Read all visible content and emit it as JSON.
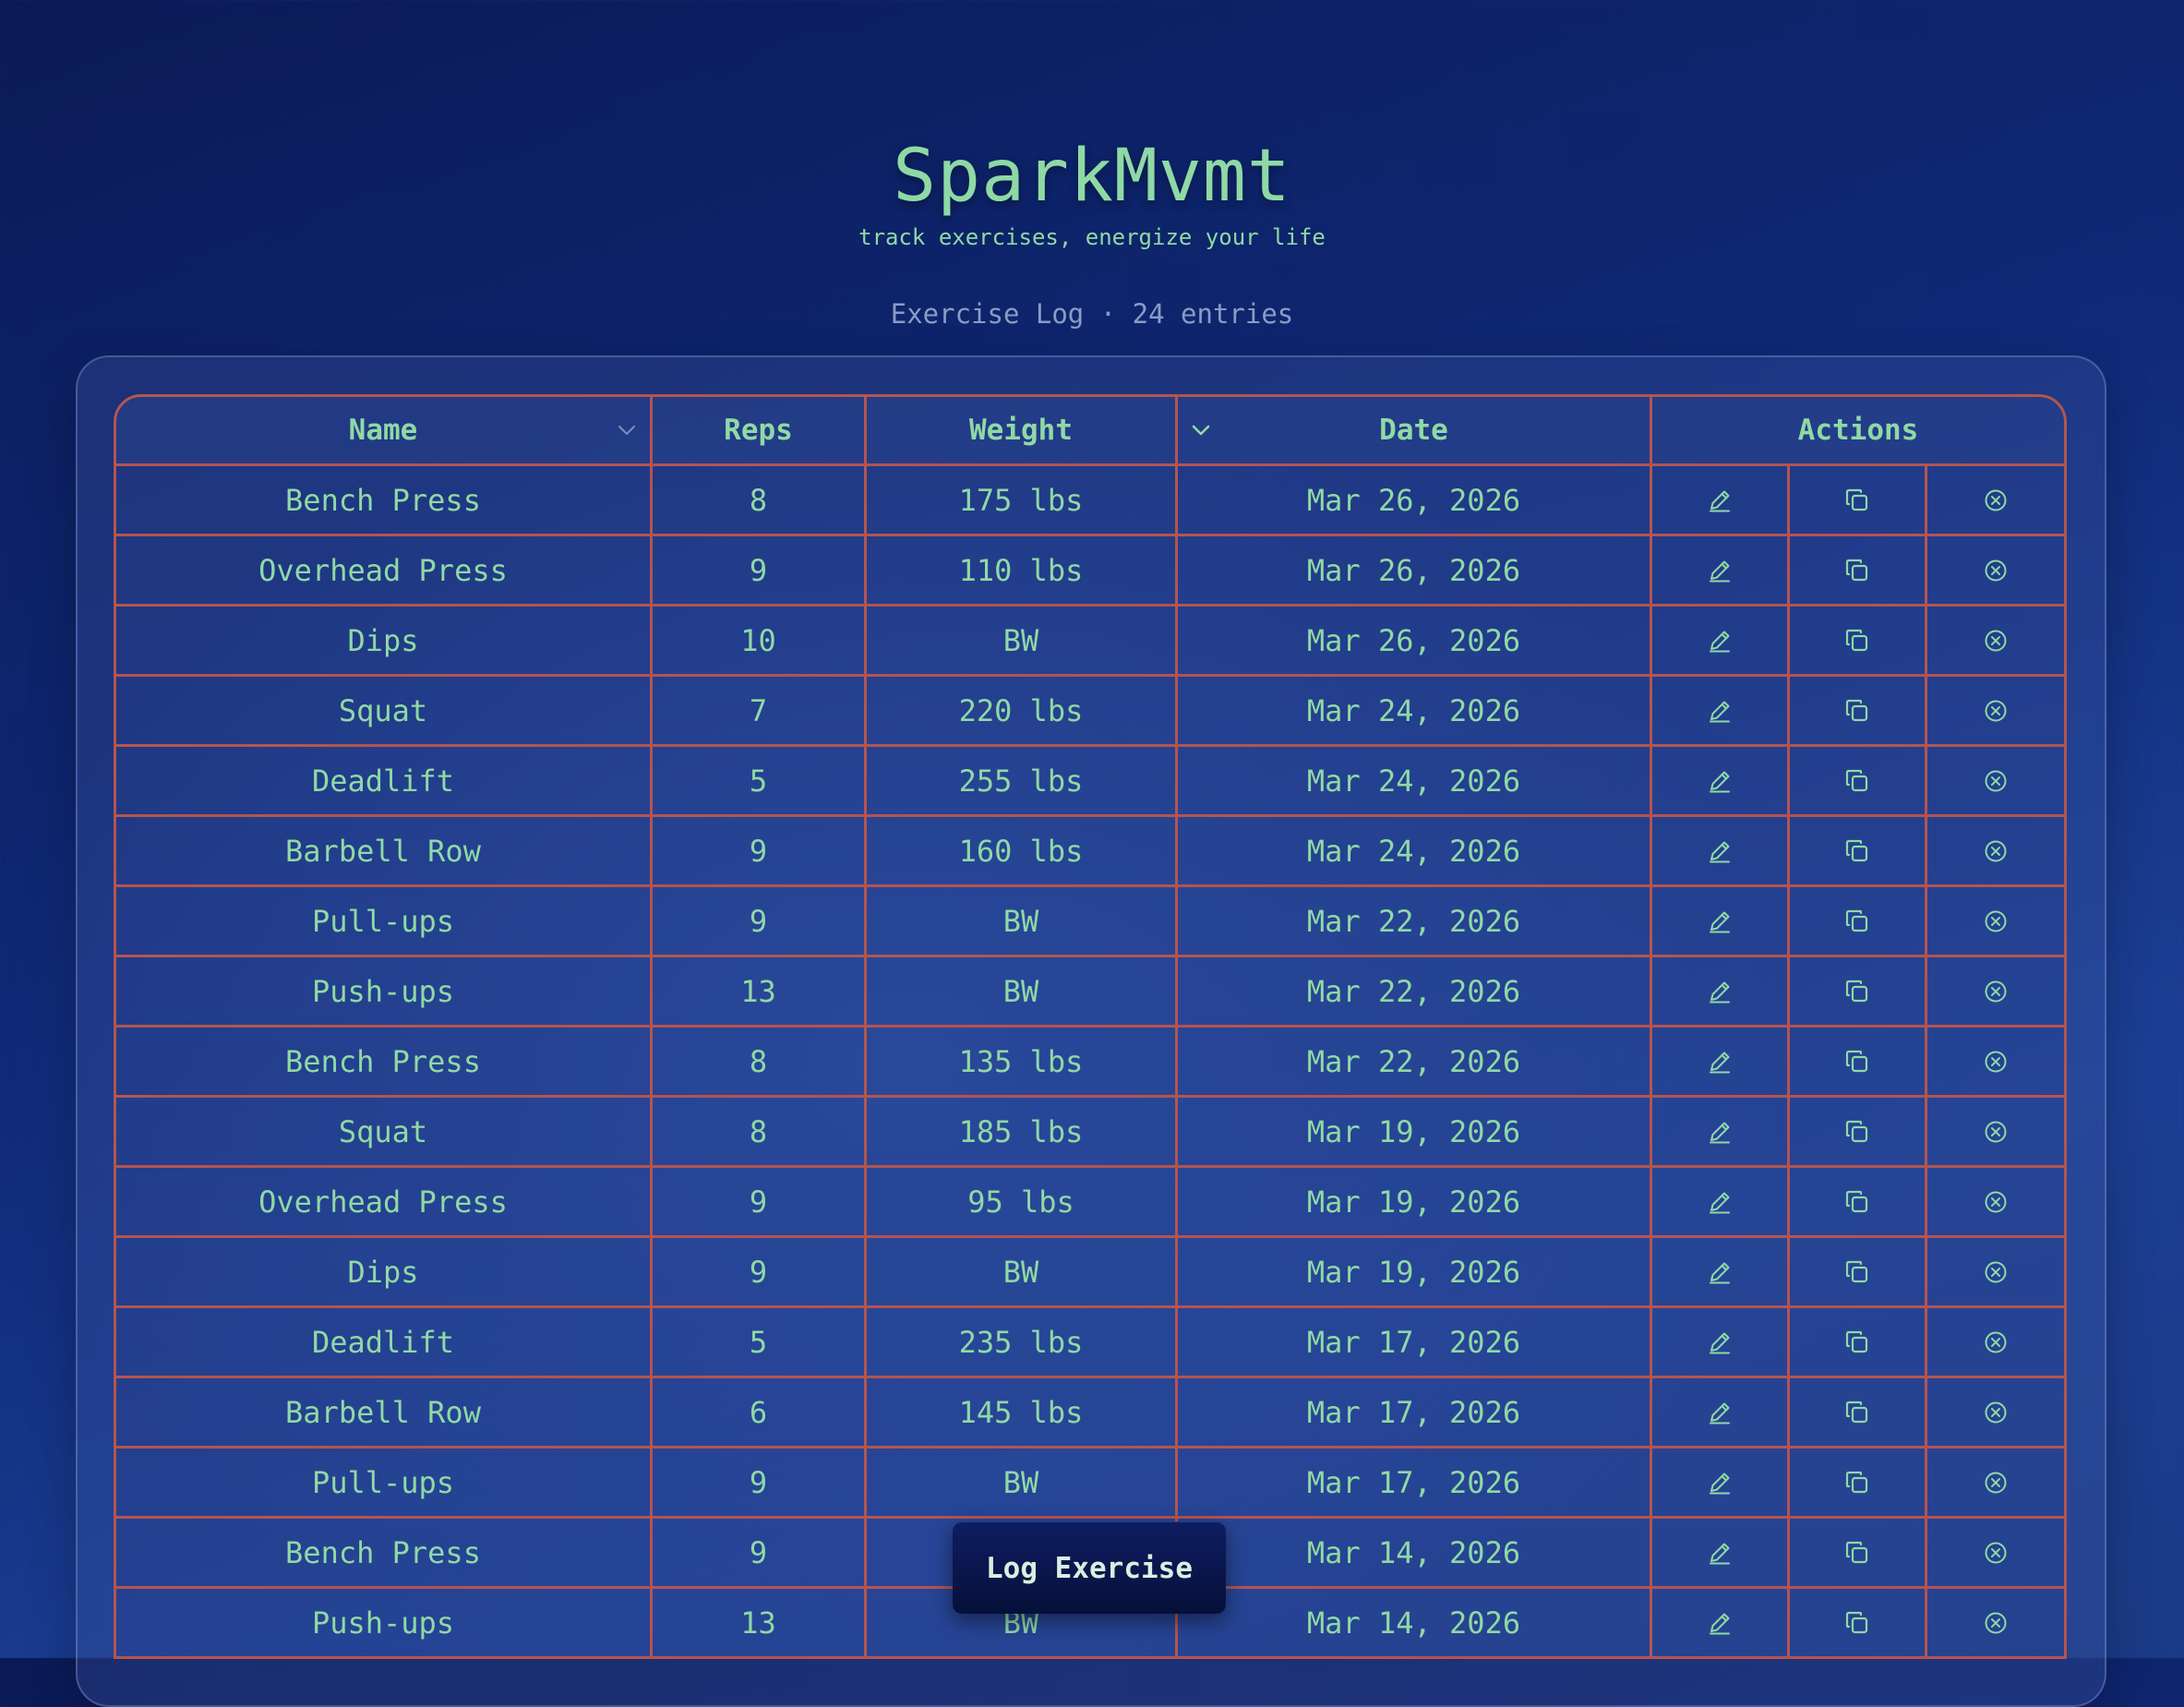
{
  "app": {
    "title": "SparkMvmt",
    "subtitle": "track exercises, energize your life",
    "log_summary": "Exercise Log · 24 entries"
  },
  "table": {
    "columns": [
      {
        "key": "name",
        "label": "Name"
      },
      {
        "key": "reps",
        "label": "Reps"
      },
      {
        "key": "weight",
        "label": "Weight"
      },
      {
        "key": "date",
        "label": "Date"
      },
      {
        "key": "actions",
        "label": "Actions"
      }
    ],
    "action_icons": [
      "pencil-icon",
      "copy-icon",
      "circle-x-icon"
    ],
    "rows": [
      {
        "name": "Bench Press",
        "reps": "8",
        "weight": "175 lbs",
        "date": "Mar 26, 2026"
      },
      {
        "name": "Overhead Press",
        "reps": "9",
        "weight": "110 lbs",
        "date": "Mar 26, 2026"
      },
      {
        "name": "Dips",
        "reps": "10",
        "weight": "BW",
        "date": "Mar 26, 2026"
      },
      {
        "name": "Squat",
        "reps": "7",
        "weight": "220 lbs",
        "date": "Mar 24, 2026"
      },
      {
        "name": "Deadlift",
        "reps": "5",
        "weight": "255 lbs",
        "date": "Mar 24, 2026"
      },
      {
        "name": "Barbell Row",
        "reps": "9",
        "weight": "160 lbs",
        "date": "Mar 24, 2026"
      },
      {
        "name": "Pull-ups",
        "reps": "9",
        "weight": "BW",
        "date": "Mar 22, 2026"
      },
      {
        "name": "Push-ups",
        "reps": "13",
        "weight": "BW",
        "date": "Mar 22, 2026"
      },
      {
        "name": "Bench Press",
        "reps": "8",
        "weight": "135 lbs",
        "date": "Mar 22, 2026"
      },
      {
        "name": "Squat",
        "reps": "8",
        "weight": "185 lbs",
        "date": "Mar 19, 2026"
      },
      {
        "name": "Overhead Press",
        "reps": "9",
        "weight": "95 lbs",
        "date": "Mar 19, 2026"
      },
      {
        "name": "Dips",
        "reps": "9",
        "weight": "BW",
        "date": "Mar 19, 2026"
      },
      {
        "name": "Deadlift",
        "reps": "5",
        "weight": "235 lbs",
        "date": "Mar 17, 2026"
      },
      {
        "name": "Barbell Row",
        "reps": "6",
        "weight": "145 lbs",
        "date": "Mar 17, 2026"
      },
      {
        "name": "Pull-ups",
        "reps": "9",
        "weight": "BW",
        "date": "Mar 17, 2026"
      },
      {
        "name": "Bench Press",
        "reps": "9",
        "weight": "",
        "date": "Mar 14, 2026"
      },
      {
        "name": "Push-ups",
        "reps": "13",
        "weight": "BW",
        "date": "Mar 14, 2026"
      }
    ]
  },
  "fab": {
    "label": "Log Exercise"
  },
  "colors": {
    "accent_text": "#8fd9a5",
    "grid_lines": "#b5544f",
    "muted_text": "#8a9cc4",
    "button_bg": "#0a1649"
  }
}
